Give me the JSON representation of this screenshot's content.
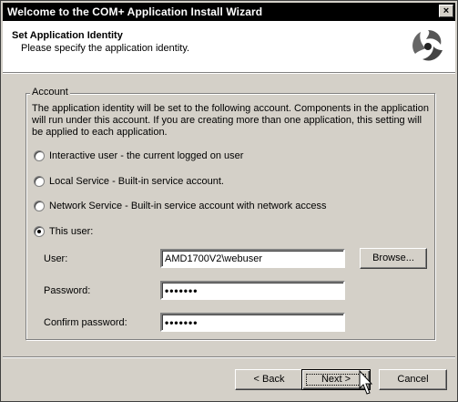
{
  "window": {
    "title": "Welcome to the COM+ Application Install Wizard",
    "close_label": "×"
  },
  "header": {
    "title": "Set Application Identity",
    "subtitle": "Please specify the application identity.",
    "logo_icon": "com-plus-swirl-icon"
  },
  "account": {
    "group_label": "Account",
    "description": "The application identity will be set to the following account.  Components in the application will run under this account.  If you are creating more than one application, this setting will be applied to each application.",
    "options": [
      {
        "label": "Interactive user - the current logged on user",
        "selected": false
      },
      {
        "label": "Local Service - Built-in service account.",
        "selected": false
      },
      {
        "label": "Network Service - Built-in service account with network access",
        "selected": false
      },
      {
        "label": "This user:",
        "selected": true
      }
    ],
    "user_label": "User:",
    "user_value": "AMD1700V2\\webuser",
    "browse_label": "Browse...",
    "password_label": "Password:",
    "password_value": "•••••••",
    "confirm_label": "Confirm password:",
    "confirm_value": "•••••••"
  },
  "buttons": {
    "back_label": "< Back",
    "next_label": "Next >",
    "cancel_label": "Cancel"
  },
  "colors": {
    "dialog_bg": "#d4d0c8",
    "titlebar_bg": "#000000",
    "header_bg": "#ffffff"
  }
}
